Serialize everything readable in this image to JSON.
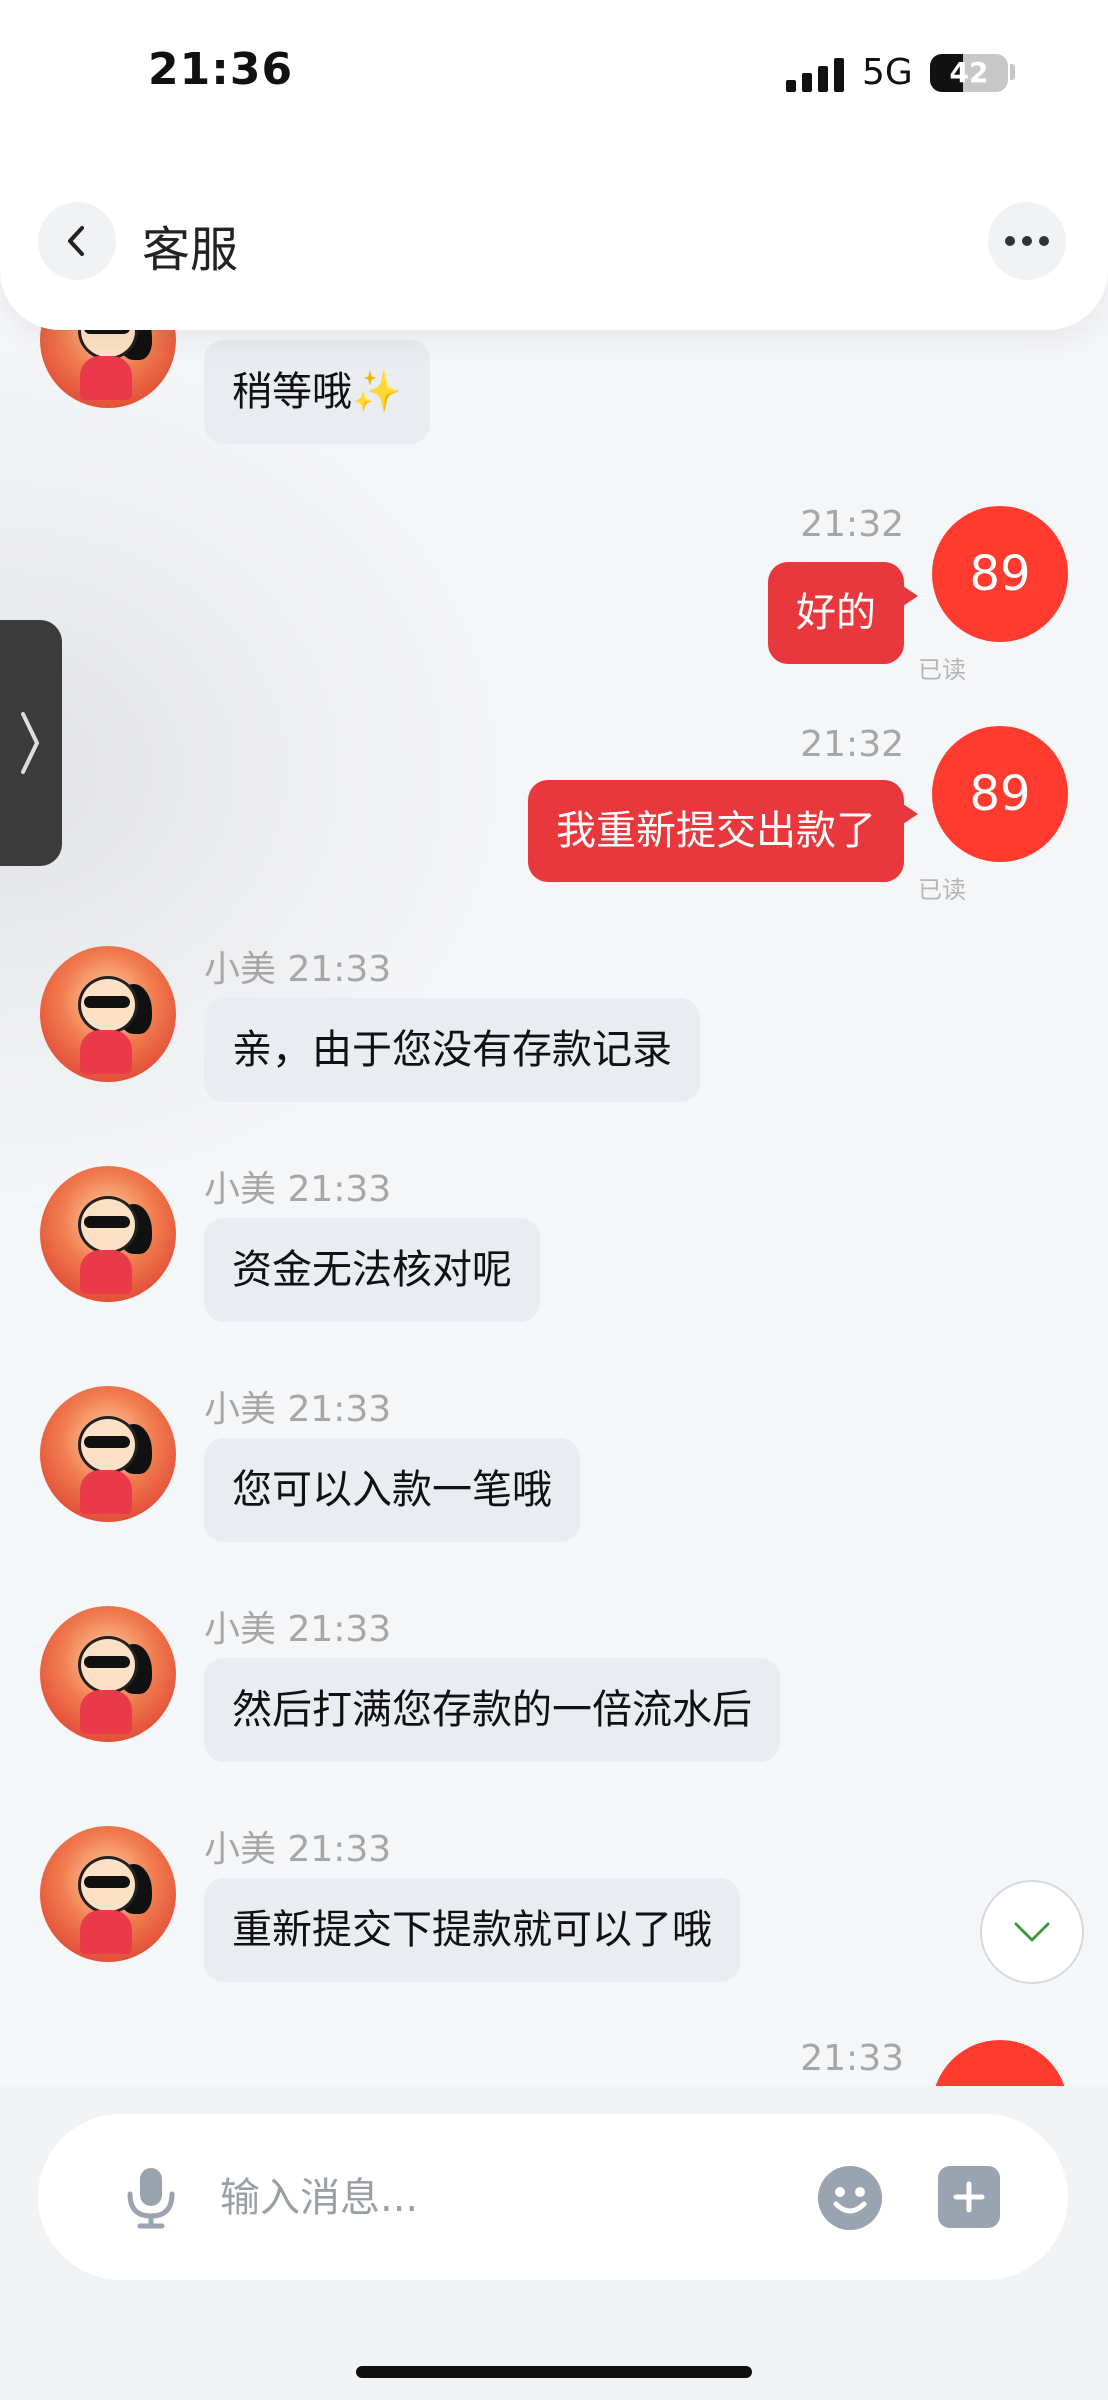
{
  "status_bar": {
    "time": "21:36",
    "network": "5G",
    "battery_level": "42",
    "battery_fraction": 0.42
  },
  "header": {
    "title": "客服"
  },
  "messages": [
    {
      "type": "in",
      "sender": "",
      "text": "稍等哦✨"
    },
    {
      "type": "out",
      "time": "21:32",
      "text": "好的",
      "badge": "89",
      "status": "已读"
    },
    {
      "type": "out",
      "time": "21:32",
      "text": "我重新提交出款了",
      "badge": "89",
      "status": "已读"
    },
    {
      "type": "in",
      "sender": "小美 21:33",
      "text": "亲，由于您没有存款记录"
    },
    {
      "type": "in",
      "sender": "小美 21:33",
      "text": "资金无法核对呢"
    },
    {
      "type": "in",
      "sender": "小美 21:33",
      "text": "您可以入款一笔哦"
    },
    {
      "type": "in",
      "sender": "小美 21:33",
      "text": "然后打满您存款的一倍流水后"
    },
    {
      "type": "in",
      "sender": "小美 21:33",
      "text": "重新提交下提款就可以了哦"
    },
    {
      "type": "out",
      "time": "21:33",
      "text": "",
      "badge": "",
      "status": ""
    }
  ],
  "input": {
    "placeholder": "输入消息..."
  },
  "colors": {
    "accent": "#e8383d",
    "badge": "#ff3b30",
    "bubble_in": "#e9ecf0"
  },
  "icons": [
    "back-arrow-icon",
    "more-dots-icon",
    "microphone-icon",
    "emoji-icon",
    "plus-icon",
    "chevron-down-icon",
    "chevron-right-icon"
  ]
}
